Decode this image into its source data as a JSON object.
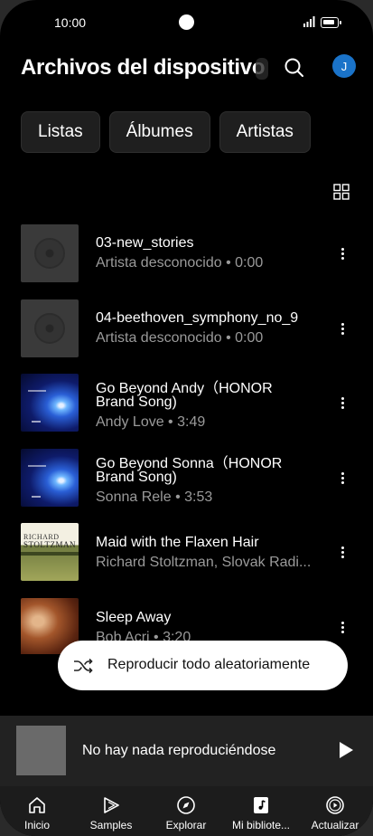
{
  "status": {
    "time": "10:00"
  },
  "header": {
    "title": "Archivos del dispositivo",
    "avatar_letter": "J"
  },
  "chips": [
    "Listas",
    "Álbumes",
    "Artistas"
  ],
  "tracks": [
    {
      "title": "03-new_stories",
      "title2": "",
      "subtitle": "Artista desconocido • 0:00",
      "art": "placeholder"
    },
    {
      "title": "04-beethoven_symphony_no_9",
      "title2": "",
      "subtitle": "Artista desconocido • 0:00",
      "art": "placeholder"
    },
    {
      "title": "Go Beyond Andy（HONOR",
      "title2": "Brand Song)",
      "subtitle": "Andy Love • 3:49",
      "art": "blue"
    },
    {
      "title": "Go Beyond Sonna（HONOR",
      "title2": "Brand Song)",
      "subtitle": "Sonna Rele • 3:53",
      "art": "blue"
    },
    {
      "title": "Maid with the Flaxen Hair",
      "title2": "",
      "subtitle": "Richard Stoltzman, Slovak Radi...",
      "art": "green",
      "art_text1": "RICHARD",
      "art_text2": "STOLTZMAN"
    },
    {
      "title": "Sleep Away",
      "title2": "",
      "subtitle": "Bob Acri • 3:20",
      "art": "brown"
    }
  ],
  "shuffle": {
    "label": "Reproducir todo aleatoriamente",
    "icon": "shuffle-icon"
  },
  "player": {
    "label": "No hay nada reproduciéndose",
    "icon": "play-icon"
  },
  "nav": [
    {
      "label": "Inicio",
      "icon": "home-icon"
    },
    {
      "label": "Samples",
      "icon": "samples-icon"
    },
    {
      "label": "Explorar",
      "icon": "compass-icon"
    },
    {
      "label": "Mi bibliote...",
      "icon": "library-icon"
    },
    {
      "label": "Actualizar",
      "icon": "upgrade-icon"
    }
  ],
  "colors": {
    "accent": "#1a73c9",
    "background": "#000000",
    "surface": "#222222"
  }
}
